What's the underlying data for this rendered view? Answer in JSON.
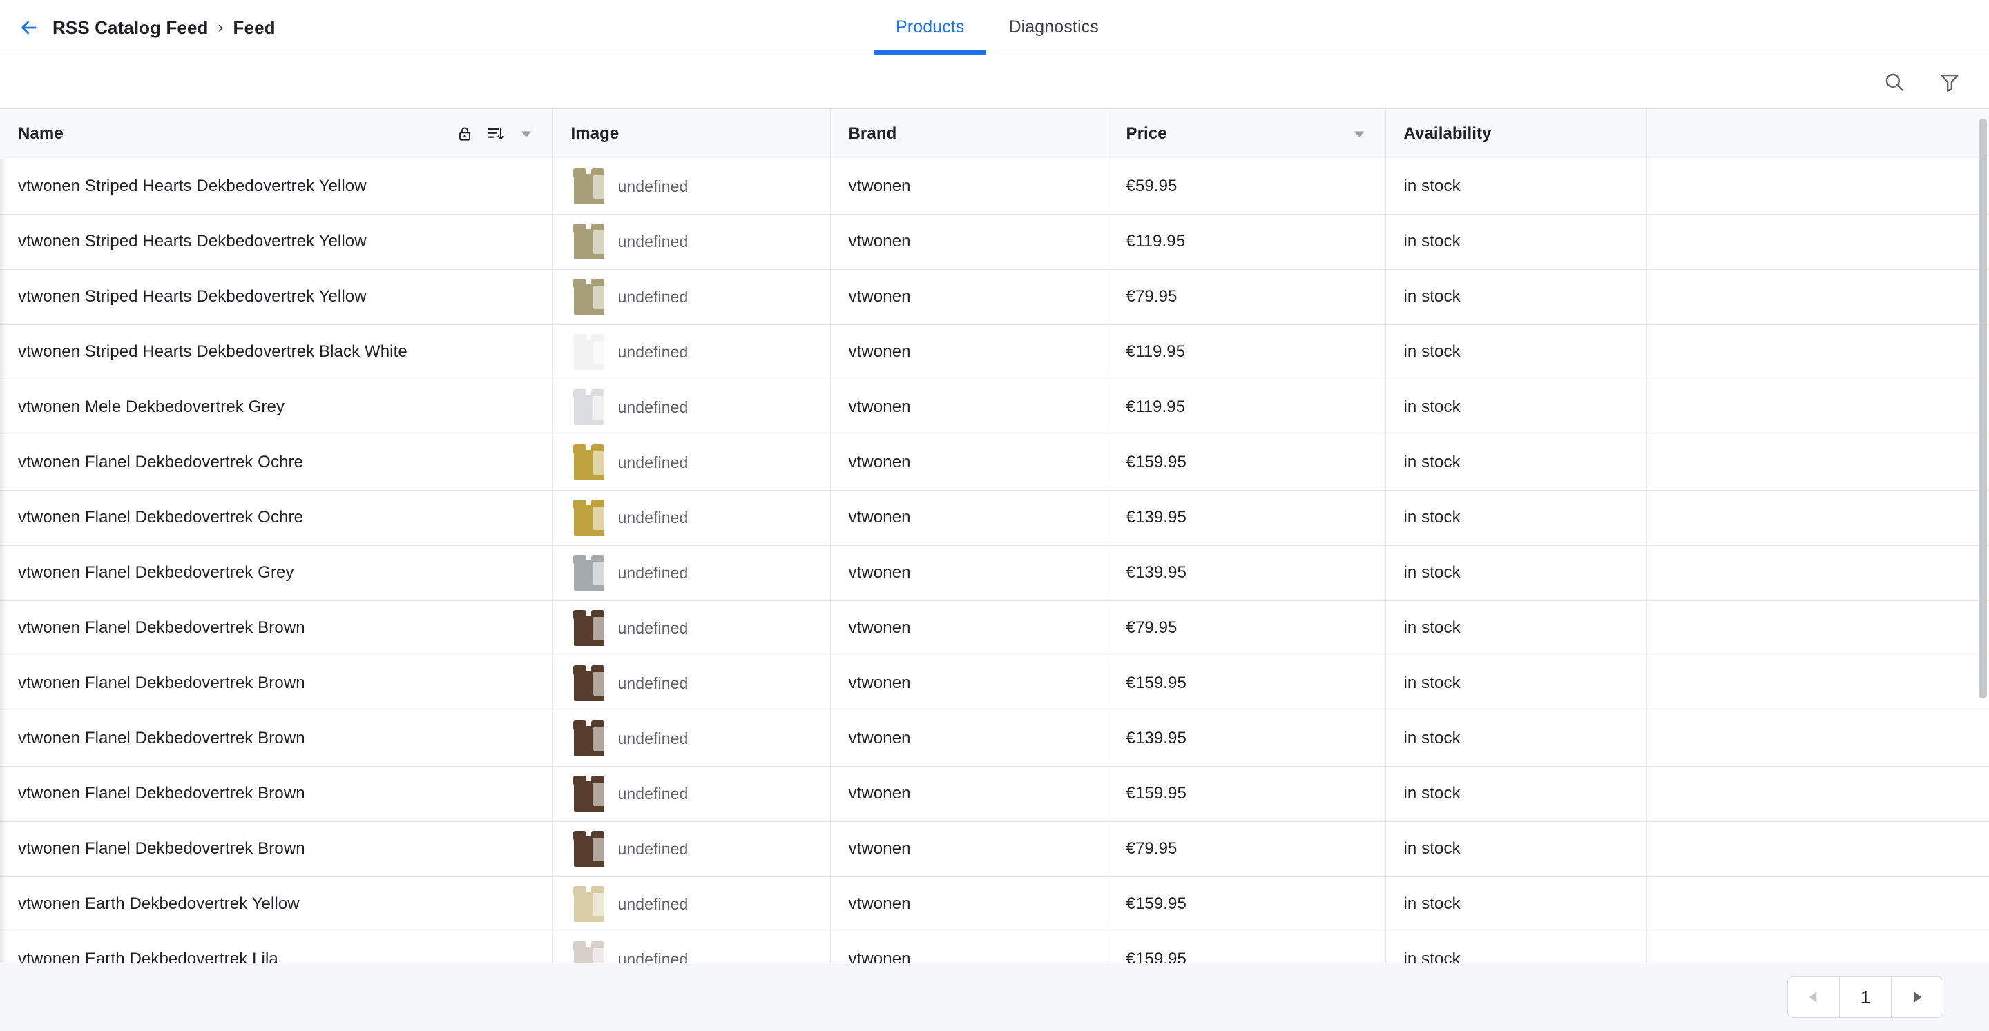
{
  "header": {
    "back_icon": "arrow-left-icon",
    "breadcrumb": {
      "parent": "RSS Catalog Feed",
      "separator": "›",
      "current": "Feed"
    },
    "tabs": [
      {
        "label": "Products",
        "active": true
      },
      {
        "label": "Diagnostics",
        "active": false
      }
    ],
    "accent_color": "#1a73e8"
  },
  "toolbar": {
    "search_icon": "search-icon",
    "filter_icon": "filter-funnel-icon"
  },
  "table": {
    "columns": [
      {
        "label": "Name",
        "icons": [
          "lock-icon",
          "sort-descending-icon",
          "chevron-down-icon"
        ]
      },
      {
        "label": "Image",
        "icons": []
      },
      {
        "label": "Brand",
        "icons": []
      },
      {
        "label": "Price",
        "icons": [
          "chevron-down-icon"
        ]
      },
      {
        "label": "Availability",
        "icons": []
      },
      {
        "label": "",
        "icons": []
      }
    ],
    "image_alt_text": "undefined",
    "rows": [
      {
        "name": "vtwonen Striped Hearts Dekbedovertrek Yellow",
        "image_alt": "undefined",
        "swatch": "#a89f78",
        "brand": "vtwonen",
        "price": "€59.95",
        "availability": "in stock"
      },
      {
        "name": "vtwonen Striped Hearts Dekbedovertrek Yellow",
        "image_alt": "undefined",
        "swatch": "#a89f78",
        "brand": "vtwonen",
        "price": "€119.95",
        "availability": "in stock"
      },
      {
        "name": "vtwonen Striped Hearts Dekbedovertrek Yellow",
        "image_alt": "undefined",
        "swatch": "#a89f78",
        "brand": "vtwonen",
        "price": "€79.95",
        "availability": "in stock"
      },
      {
        "name": "vtwonen Striped Hearts Dekbedovertrek Black White",
        "image_alt": "undefined",
        "swatch": "#f2f2f2",
        "brand": "vtwonen",
        "price": "€119.95",
        "availability": "in stock"
      },
      {
        "name": "vtwonen Mele Dekbedovertrek Grey",
        "image_alt": "undefined",
        "swatch": "#dcdde0",
        "brand": "vtwonen",
        "price": "€119.95",
        "availability": "in stock"
      },
      {
        "name": "vtwonen Flanel Dekbedovertrek Ochre",
        "image_alt": "undefined",
        "swatch": "#bda23f",
        "brand": "vtwonen",
        "price": "€159.95",
        "availability": "in stock"
      },
      {
        "name": "vtwonen Flanel Dekbedovertrek Ochre",
        "image_alt": "undefined",
        "swatch": "#bda23f",
        "brand": "vtwonen",
        "price": "€139.95",
        "availability": "in stock"
      },
      {
        "name": "vtwonen Flanel Dekbedovertrek Grey",
        "image_alt": "undefined",
        "swatch": "#a4a9ae",
        "brand": "vtwonen",
        "price": "€139.95",
        "availability": "in stock"
      },
      {
        "name": "vtwonen Flanel Dekbedovertrek Brown",
        "image_alt": "undefined",
        "swatch": "#553c2c",
        "brand": "vtwonen",
        "price": "€79.95",
        "availability": "in stock"
      },
      {
        "name": "vtwonen Flanel Dekbedovertrek Brown",
        "image_alt": "undefined",
        "swatch": "#553c2c",
        "brand": "vtwonen",
        "price": "€159.95",
        "availability": "in stock"
      },
      {
        "name": "vtwonen Flanel Dekbedovertrek Brown",
        "image_alt": "undefined",
        "swatch": "#553c2c",
        "brand": "vtwonen",
        "price": "€139.95",
        "availability": "in stock"
      },
      {
        "name": "vtwonen Flanel Dekbedovertrek Brown",
        "image_alt": "undefined",
        "swatch": "#553c2c",
        "brand": "vtwonen",
        "price": "€159.95",
        "availability": "in stock"
      },
      {
        "name": "vtwonen Flanel Dekbedovertrek Brown",
        "image_alt": "undefined",
        "swatch": "#553c2c",
        "brand": "vtwonen",
        "price": "€79.95",
        "availability": "in stock"
      },
      {
        "name": "vtwonen Earth Dekbedovertrek Yellow",
        "image_alt": "undefined",
        "swatch": "#d8cda4",
        "brand": "vtwonen",
        "price": "€159.95",
        "availability": "in stock"
      },
      {
        "name": "vtwonen Earth Dekbedovertrek Lila",
        "image_alt": "undefined",
        "swatch": "#d9cfc9",
        "brand": "vtwonen",
        "price": "€159.95",
        "availability": "in stock"
      }
    ]
  },
  "pagination": {
    "prev_icon": "triangle-left-icon",
    "page": "1",
    "next_icon": "triangle-right-icon"
  }
}
